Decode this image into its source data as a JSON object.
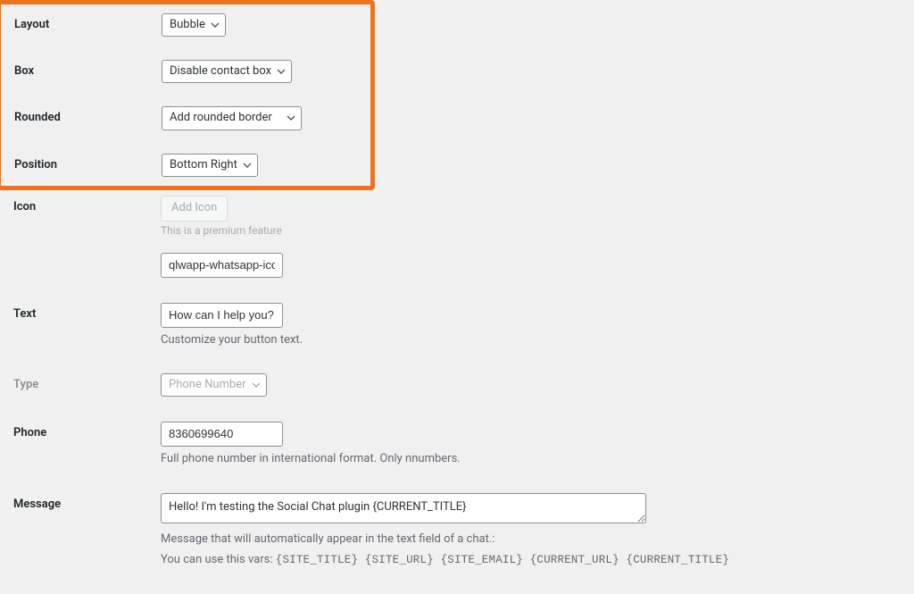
{
  "highlight": {
    "layout": {
      "label": "Layout",
      "value": "Bubble"
    },
    "box": {
      "label": "Box",
      "value": "Disable contact box"
    },
    "rounded": {
      "label": "Rounded",
      "value": "Add rounded border"
    },
    "position": {
      "label": "Position",
      "value": "Bottom Right"
    }
  },
  "icon": {
    "label": "Icon",
    "button": "Add Icon",
    "premium_note": "This is a premium feature",
    "input_value": "qlwapp-whatsapp-icon"
  },
  "text": {
    "label": "Text",
    "value": "How can I help you?",
    "description": "Customize your button text."
  },
  "type": {
    "label": "Type",
    "value": "Phone Number"
  },
  "phone": {
    "label": "Phone",
    "value": "8360699640",
    "description": "Full phone number in international format. Only nnumbers."
  },
  "message": {
    "label": "Message",
    "value": "Hello! I'm testing the Social Chat plugin {CURRENT_TITLE}",
    "description1": "Message that will automatically appear in the text field of a chat.:",
    "description2_prefix": "You can use this vars: ",
    "vars": "{SITE_TITLE} {SITE_URL} {SITE_EMAIL} {CURRENT_URL} {CURRENT_TITLE}"
  }
}
